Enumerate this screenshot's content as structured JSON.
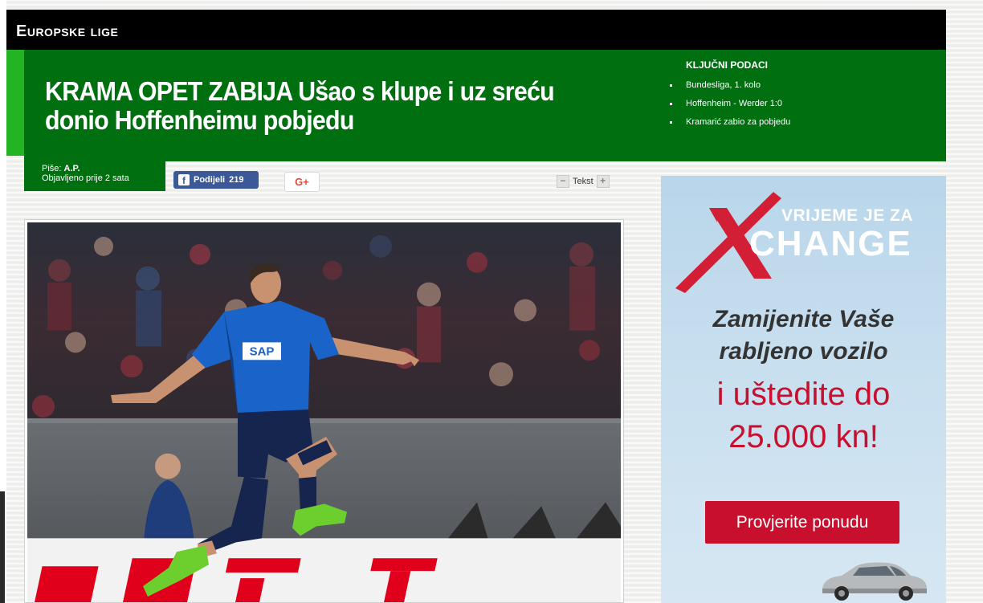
{
  "section": {
    "title": "Europske lige"
  },
  "article": {
    "headline": "KRAMA OPET ZABIJA Ušao s klupe i uz sreću donio Hoffenheimu pobjedu",
    "author_label": "Piše:",
    "author": "A.P.",
    "published": "Objavljeno prije 2 sata"
  },
  "key_facts": {
    "title": "KLJUČNI PODACI",
    "items": [
      "Bundesliga, 1. kolo",
      "Hoffenheim - Werder 1:0",
      "Kramarić zabio za pobjedu"
    ]
  },
  "share": {
    "facebook_label": "Podijeli",
    "facebook_count": "219",
    "gplus_label": "G+"
  },
  "text_size": {
    "label": "Tekst",
    "decrease": "−",
    "increase": "+"
  },
  "photo": {
    "jersey_text": "SAP"
  },
  "ad": {
    "brand_top": "VRIJEME JE ZA",
    "brand_main": "CHANGE",
    "line1": "Zamijenite Vaše",
    "line2": "rabljeno vozilo",
    "line3": "i uštedite do",
    "line4": "25.000 kn!",
    "cta": "Provjerite ponudu"
  },
  "colors": {
    "header_green": "#006f10",
    "accent_green": "#22b422",
    "facebook": "#3b5998",
    "ad_red": "#c8102e"
  }
}
